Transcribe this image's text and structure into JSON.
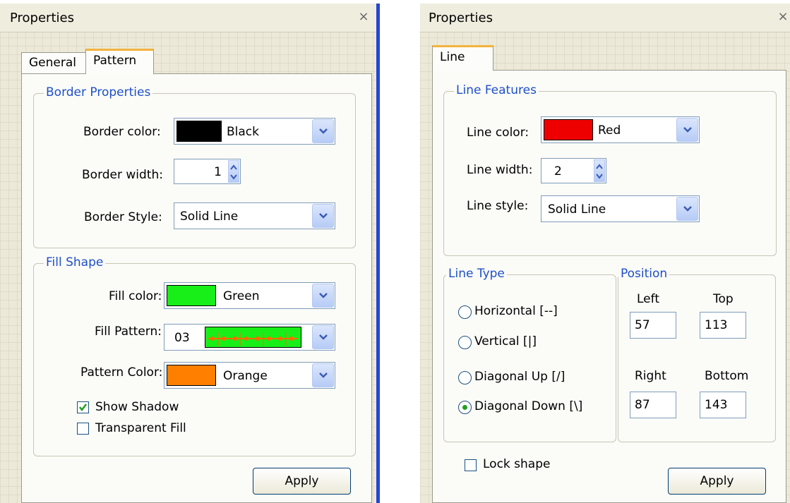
{
  "left": {
    "title": "Properties",
    "close": "×",
    "tabs": [
      "General",
      "Pattern"
    ],
    "active_tab": "Pattern",
    "border_group": {
      "title": "Border Properties",
      "color_label": "Border color:",
      "color_value": "Black",
      "color_swatch": "#000000",
      "width_label": "Border width:",
      "width_value": "1",
      "style_label": "Border Style:",
      "style_value": "Solid Line"
    },
    "fill_group": {
      "title": "Fill Shape",
      "fill_color_label": "Fill color:",
      "fill_color_value": "Green",
      "fill_swatch": "#18ee18",
      "pattern_label": "Fill Pattern:",
      "pattern_value": "03",
      "pattern_swatch": "#18ee18",
      "pattern_dots": "#ff6a00",
      "pattern_color_label": "Pattern Color:",
      "pattern_color_value": "Orange",
      "pattern_color_swatch": "#ff8000",
      "show_shadow_label": "Show Shadow",
      "show_shadow_checked": true,
      "transparent_label": "Transparent Fill",
      "transparent_checked": false
    },
    "apply_label": "Apply"
  },
  "right": {
    "title": "Properties",
    "close": "×",
    "tabs": [
      "Line"
    ],
    "active_tab": "Line",
    "features_group": {
      "title": "Line Features",
      "color_label": "Line color:",
      "color_value": "Red",
      "color_swatch": "#ee0000",
      "width_label": "Line width:",
      "width_value": "2",
      "style_label": "Line style:",
      "style_value": "Solid Line"
    },
    "type_group": {
      "title": "Line Type",
      "options": [
        "Horizontal [--]",
        "Vertical [|]",
        "Diagonal Up [/]",
        "Diagonal Down [\\]"
      ],
      "selected": "Diagonal Down [\\]"
    },
    "position_group": {
      "title": "Position",
      "left_label": "Left",
      "left_value": "57",
      "top_label": "Top",
      "top_value": "113",
      "right_label": "Right",
      "right_value": "87",
      "bottom_label": "Bottom",
      "bottom_value": "143"
    },
    "lock_label": "Lock shape",
    "lock_checked": false,
    "apply_label": "Apply"
  },
  "colors": {
    "accent_blue": "#1e50c8",
    "tab_highlight": "#f3b33d",
    "divider_blue": "#2346d6"
  }
}
